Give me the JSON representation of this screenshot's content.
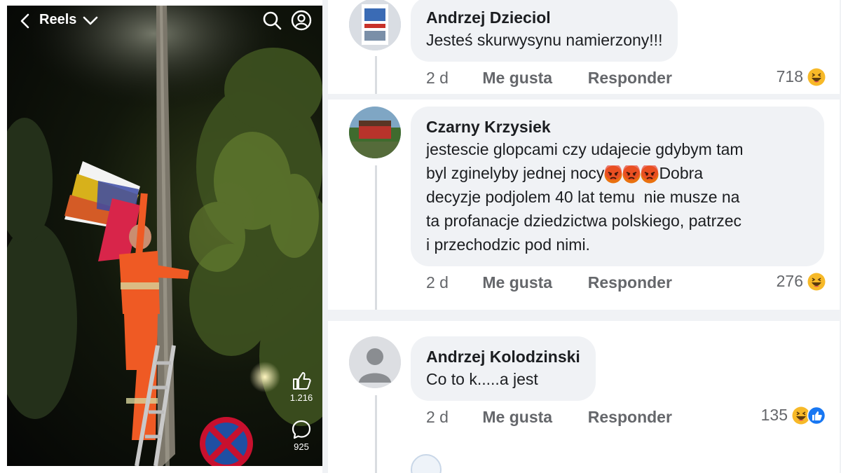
{
  "reel": {
    "title": "Reels",
    "like_count": "1.216",
    "comment_count": "925"
  },
  "comments": [
    {
      "author": "Andrzej Dzieciol",
      "text": "Jesteś skurwysynu namierzony!!!",
      "time": "2 d",
      "like_label": "Me gusta",
      "reply_label": "Responder",
      "reaction_count": "718"
    },
    {
      "author": "Czarny Krzysiek",
      "text_lines": [
        "jestescie glopcami czy udajecie gdybym tam",
        "byl zginelyby jednej nocy",
        "Dobra",
        "decyzje podjolem 40 lat temu  nie musze na",
        "ta profanacje dziedzictwa polskiego, patrzec",
        "i przechodzic pod nimi."
      ],
      "time": "2 d",
      "like_label": "Me gusta",
      "reply_label": "Responder",
      "reaction_count": "276"
    },
    {
      "author": "Andrzej Kolodzinski",
      "text": "Co to k.....a jest",
      "time": "2 d",
      "like_label": "Me gusta",
      "reply_label": "Responder",
      "reaction_count": "135"
    }
  ],
  "colors": {
    "bubble": "#f0f2f5",
    "meta": "#65676b",
    "text": "#1c1e21",
    "like_blue": "#1877f2",
    "haha_yellow": "#f7b928",
    "angry_red": "#e9710f"
  }
}
